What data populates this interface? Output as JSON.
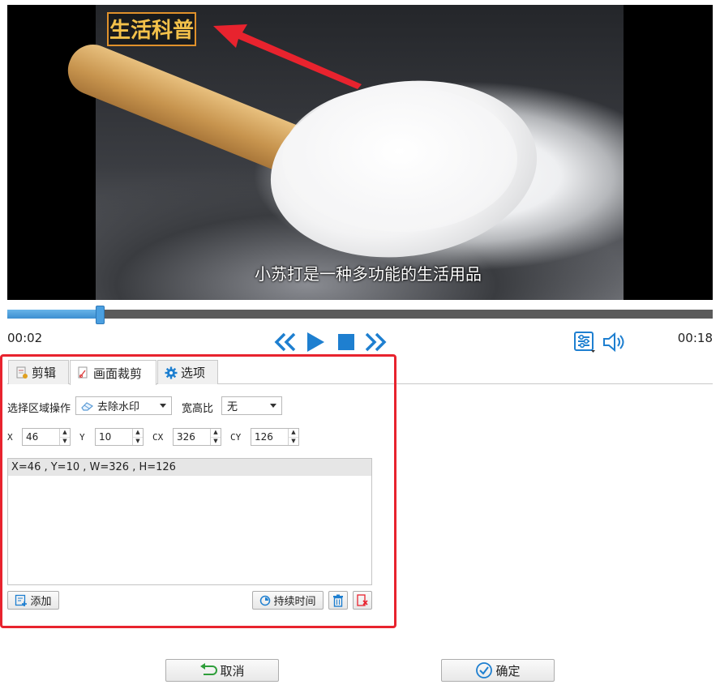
{
  "video": {
    "logo_text": "生活科普",
    "subtitle": "小苏打是一种多功能的生活用品"
  },
  "player": {
    "current_time": "00:02",
    "end_time": "00:18",
    "progress": 0.132
  },
  "tabs": [
    {
      "label": "剪辑",
      "icon": "clip-icon"
    },
    {
      "label": "画面裁剪",
      "icon": "crop-icon"
    },
    {
      "label": "选项",
      "icon": "gear-icon"
    }
  ],
  "region": {
    "op_label": "选择区域操作",
    "op_value": "去除水印",
    "aspect_label": "宽高比",
    "aspect_value": "无"
  },
  "coords": {
    "x_label": "X",
    "x_value": "46",
    "y_label": "Y",
    "y_value": "10",
    "cx_label": "CX",
    "cx_value": "326",
    "cy_label": "CY",
    "cy_value": "126"
  },
  "list": {
    "items": [
      "X=46 , Y=10 , W=326 , H=126"
    ]
  },
  "actions": {
    "add_label": "添加",
    "duration_label": "持续时间"
  },
  "footer": {
    "cancel_label": "取消",
    "ok_label": "确定"
  },
  "colors": {
    "accent": "#1e7fd0",
    "highlight": "#e8232e",
    "logo_border": "#e0912b"
  }
}
